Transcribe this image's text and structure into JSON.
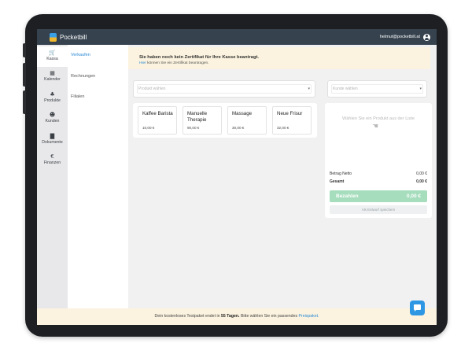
{
  "app": {
    "name": "Pocketbill"
  },
  "header": {
    "email": "helmut@pocketbill.at"
  },
  "nav": {
    "items": [
      {
        "label": "Kassa",
        "icon": "🛒"
      },
      {
        "label": "Kalender",
        "icon": "▦"
      },
      {
        "label": "Produkte",
        "icon": "♣"
      },
      {
        "label": "Kunden",
        "icon": "☻"
      },
      {
        "label": "Dokumente",
        "icon": "▇"
      },
      {
        "label": "Finanzen",
        "icon": "€"
      }
    ]
  },
  "subnav": {
    "items": [
      "Verkaufen",
      "Rechnungen",
      "Filialen"
    ]
  },
  "notice": {
    "title": "Sie haben noch kein Zertifikat für Ihre Kasse beantragt.",
    "link": "Hier",
    "rest": "können Sie ein Zertifikat beantragen."
  },
  "product_select": {
    "placeholder": "Produkt wählen",
    "caret": "▾"
  },
  "customer_select": {
    "placeholder": "Kunde wählen",
    "caret": "▾"
  },
  "products": [
    {
      "name": "Kaffee Barista",
      "price": "10,00 €"
    },
    {
      "name": "Manuelle Therapie",
      "price": "90,00 €"
    },
    {
      "name": "Massage",
      "price": "30,00 €"
    },
    {
      "name": "Neue Frisur",
      "price": "32,00 €"
    }
  ],
  "cart": {
    "empty_text": "Wählen Sie ein Produkt aus der Liste",
    "hand_icon": "☚",
    "net_label": "Betrag Netto",
    "net_value": "0,00 €",
    "total_label": "Gesamt",
    "total_value": "0,00 €",
    "pay_label": "Bezahlen",
    "pay_value": "0,00 €",
    "draft_label": "Als Entwurf speichern"
  },
  "footer": {
    "prefix": "Dein kostenloses Testpaket endet in",
    "days": "55 Tagen.",
    "middle": "Bitte wählen Sie ein passendes",
    "link": "Preispaket."
  },
  "colors": {
    "topbar": "#36434f",
    "accent": "#2a8ad6",
    "pay": "#a6ddbd",
    "banner": "#fbf3df"
  }
}
